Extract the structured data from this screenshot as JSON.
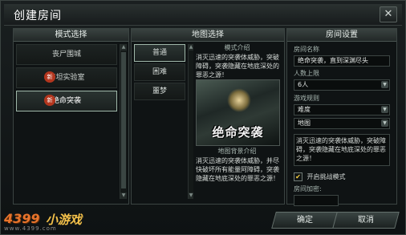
{
  "window": {
    "title": "创建房间",
    "close_glyph": "✕"
  },
  "modes_panel": {
    "header": "模式选择",
    "items": [
      {
        "label": "丧尸围城",
        "new": false,
        "selected": false
      },
      {
        "label": "泰坦实验室",
        "new": true,
        "selected": false
      },
      {
        "label": "绝命突袭",
        "new": true,
        "selected": true
      }
    ],
    "new_badge": "新"
  },
  "map_panel": {
    "header": "地图选择",
    "difficulties": [
      {
        "label": "普通",
        "selected": true
      },
      {
        "label": "困难",
        "selected": false
      },
      {
        "label": "噩梦",
        "selected": false
      }
    ],
    "mode_intro_title": "模式介绍",
    "mode_intro_text": "消灭迅速的突袭体威胁，突破障碍，突袭隐藏在地底深处的罪恶之源！",
    "map_image_text": "绝命突袭",
    "map_bg_title": "地图背景介绍",
    "map_bg_text": "消灭迅速的突袭体威胁，并尽快破坏所有能量阿障碍，突袭隐藏在地底深处的罪恶之源！"
  },
  "room_panel": {
    "header": "房间设置",
    "room_name_label": "房间名称",
    "room_name_value": "绝命突袭，直到深渊尽头",
    "max_players_label": "人数上限",
    "max_players_value": "6人",
    "game_rule_label": "游戏规则",
    "rule_value_1": "难度",
    "rule_value_2": "地图",
    "rule_desc": "消灭迅速的突袭体威胁，突破障碍，突袭隐藏在地底深处的罪恶之源！",
    "challenge_label": "开启挑战模式",
    "challenge_checked": true,
    "password_label": "房间加密:",
    "dropdown_glyph": "▼",
    "check_glyph": "✔"
  },
  "footer": {
    "confirm_label": "确定",
    "cancel_label": "取消",
    "watermark_num": "4399",
    "watermark_text": "小游戏",
    "watermark_url": "www.4399.com"
  },
  "colors": {
    "accent_selected": "#9fb7a9",
    "new_badge": "#b3361e",
    "checkmark": "#ffd541"
  }
}
